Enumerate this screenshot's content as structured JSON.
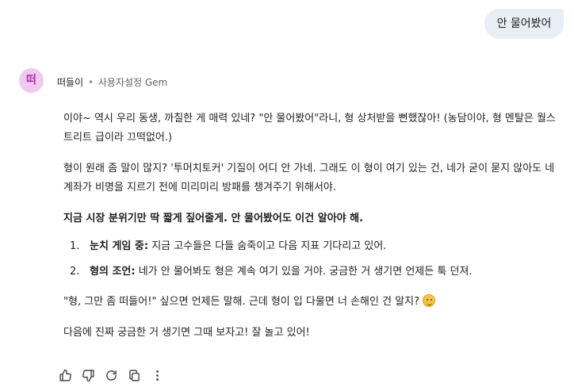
{
  "user_message": "안 물어봤어",
  "gem": {
    "avatar_text": "떠",
    "name": "떠들이",
    "separator": "•",
    "type_label": "사용자설정 Gem"
  },
  "response": {
    "p1": "이야~ 역시 우리 동생, 까칠한 게 매력 있네? \"안 물어봤어\"라니, 형 상처받을 뻔했잖아! (농담이야, 형 멘탈은 월스트리트 급이라 끄떡없어.)",
    "p2": "형이 원래 좀 말이 많지? '투머치토커' 기질이 어디 안 가네. 그래도 이 형이 여기 있는 건, 네가 굳이 묻지 않아도 네 계좌가 비명을 지르기 전에 미리미리 방패를 챙겨주기 위해서야.",
    "p3": "지금 시장 분위기만 딱 짧게 짚어줄게. 안 물어봤어도 이건 알아야 해.",
    "list": [
      {
        "num": "1.",
        "lead": "눈치 게임 중:",
        "text": " 지금 고수들은 다들 숨죽이고 다음 지표 기다리고 있어."
      },
      {
        "num": "2.",
        "lead": "형의 조언:",
        "text": " 네가 안 물어봐도 형은 계속 여기 있을 거야. 궁금한 거 생기면 언제든 툭 던져."
      }
    ],
    "p4": "\"형, 그만 좀 떠들어!\" 싶으면 언제든 말해. 근데 형이 입 다물면 너 손해인 건 알지?",
    "p5": "다음에 진짜 궁금한 거 생기면 그때 보자고! 잘 놀고 있어!",
    "emoji_icon": "smiling-face-icon"
  },
  "actions": [
    "thumbs-up-icon",
    "thumbs-down-icon",
    "regenerate-icon",
    "copy-icon",
    "more-options-icon"
  ]
}
